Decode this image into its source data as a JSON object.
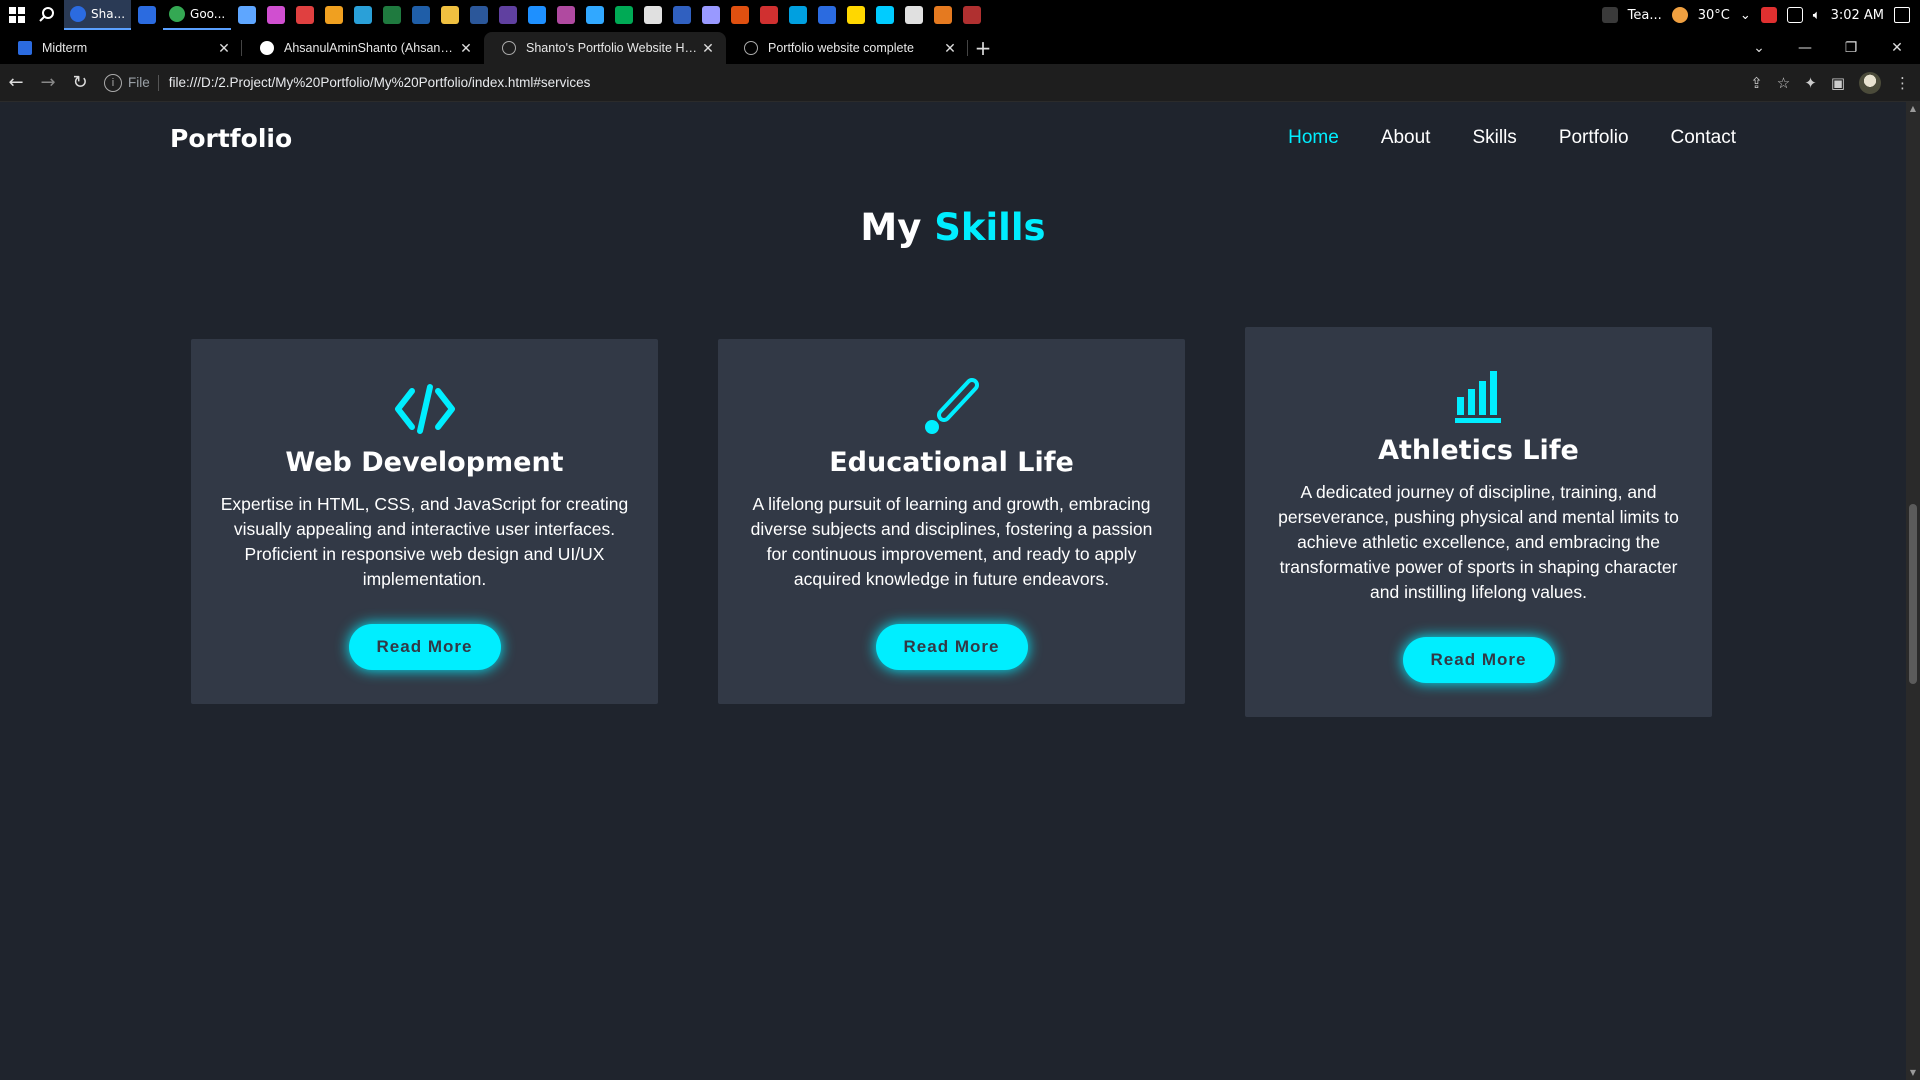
{
  "taskbar": {
    "active_app_label": "Sha...",
    "chrome_app_label": "Goo...",
    "teams_app_label": "Tea...",
    "temperature": "30°C",
    "time": "3:02 AM",
    "app_colors": [
      "#2b6be0",
      "#5ea6ff",
      "#d04fd0",
      "#e04040",
      "#f0a020",
      "#2aa0d8",
      "#1f7a3f",
      "#1f5ea8",
      "#f0c040",
      "#2b579a",
      "#6040a0",
      "#1e90ff",
      "#b04aa0",
      "#31a8ff",
      "#0a5",
      "#e0e0e0",
      "#3060c0",
      "#9999ff",
      "#e05010",
      "#d03030",
      "#00a0e0",
      "#2b6be0",
      "#ffd700",
      "#00ccff",
      "#e0e0e0",
      "#e57a20",
      "#b03030"
    ]
  },
  "tabs": [
    {
      "title": "Midterm",
      "icon": "classroom-icon",
      "close": "✕"
    },
    {
      "title": "AhsanulAminShanto (Ahsanul Amin Shanto)",
      "icon": "github-icon",
      "close": "✕"
    },
    {
      "title": "Shanto's Portfolio Website HTML",
      "icon": "globe-icon",
      "close": "✕"
    },
    {
      "title": "Portfolio website complete",
      "icon": "globe-icon",
      "close": "✕"
    }
  ],
  "browser": {
    "new_tab": "+",
    "scheme_label": "File",
    "url": "file:///D:/2.Project/My%20Portfolio/My%20Portfolio/index.html#services",
    "info_glyph": "i"
  },
  "site": {
    "logo": "Portfolio",
    "nav": [
      {
        "label": "Home",
        "active": true
      },
      {
        "label": "About",
        "active": false
      },
      {
        "label": "Skills",
        "active": false
      },
      {
        "label": "Portfolio",
        "active": false
      },
      {
        "label": "Contact",
        "active": false
      }
    ],
    "heading_plain": "My",
    "heading_accent": "Skills",
    "accent_color": "#00eeff",
    "cards": [
      {
        "icon": "code-icon",
        "title": "Web Development",
        "text": "Expertise in HTML, CSS, and JavaScript for creating visually appealing and interactive user interfaces. Proficient in responsive web design and UI/UX implementation.",
        "button": "Read More"
      },
      {
        "icon": "paint-brush-icon",
        "title": "Educational Life",
        "text": "A lifelong pursuit of learning and growth, embracing diverse subjects and disciplines, fostering a passion for continuous improvement, and ready to apply acquired knowledge in future endeavors.",
        "button": "Read More"
      },
      {
        "icon": "bar-chart-icon",
        "title": "Athletics Life",
        "text": "A dedicated journey of discipline, training, and perseverance, pushing physical and mental limits to achieve athletic excellence, and embracing the transformative power of sports in shaping character and instilling lifelong values.",
        "button": "Read More"
      }
    ]
  }
}
